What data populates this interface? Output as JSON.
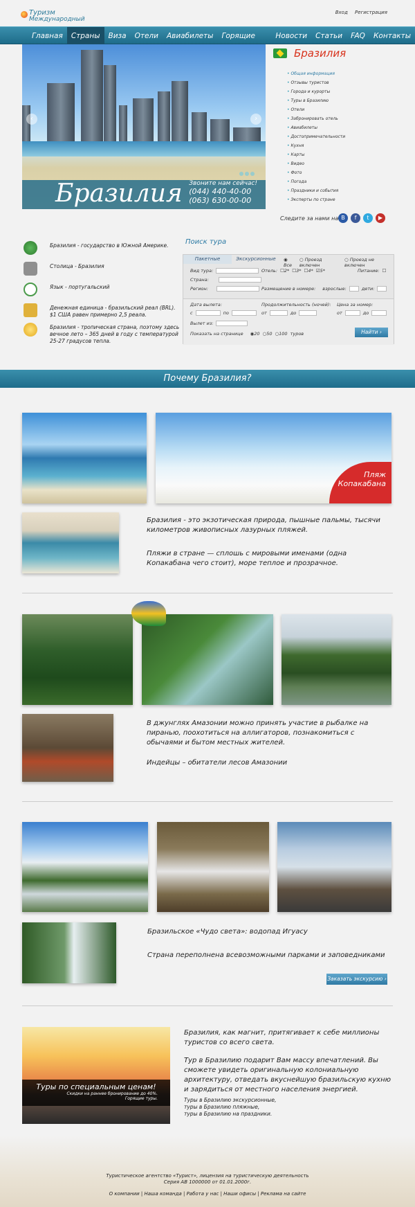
{
  "logo": {
    "line1": "Туризм",
    "line2": "Международный"
  },
  "top_links": {
    "login": "Вход",
    "register": "Регистрация"
  },
  "nav": [
    "Главная",
    "Страны",
    "Виза",
    "Отели",
    "Авиабилеты",
    "Горящие туры",
    "Новости",
    "Статьи",
    "FAQ",
    "Контакты"
  ],
  "nav_active": "Страны",
  "hero": {
    "title": "Бразилия",
    "call": "Звоните нам сейчас!",
    "phone1": "(044) 440-40-00",
    "phone2": "(063) 630-00-00"
  },
  "side": {
    "title": "Бразилия",
    "items": [
      "Общая информация",
      "Отзывы туристов",
      "Города и курорты",
      "Туры в Бразилию",
      "Отели",
      "Забронировать отель",
      "Авиабилеты",
      "Достопримечательности",
      "Кухня",
      "Карты",
      "Видео",
      "Фото",
      "Погода",
      "Праздники и события",
      "Эксперты по стране"
    ],
    "active": "Общая информация"
  },
  "follow": "Следите за нами на",
  "social": [
    "B",
    "f",
    "t",
    "▶"
  ],
  "facts": [
    "Бразилия - государство в Южной Америке.",
    "Столица - Бразилия",
    "Язык - португальский",
    "Денежная единица - бразильский реал (BRL). $1 США равен примерно 2,5 реала.",
    "Бразилия - тропическая страна, поэтому здесь вечное лето – 365 дней в году с температурой 25-27 градусов тепла."
  ],
  "search": {
    "title": "Поиск тура",
    "tabs": [
      "Пакетные",
      "Экскурсионные"
    ],
    "transport": [
      "Все",
      "Проезд включен",
      "Проезд не включен"
    ],
    "tour_type": "Вид тура:",
    "hotel": "Отель:",
    "stars": [
      "2*",
      "3*",
      "4*",
      "5*"
    ],
    "food": "Питание:",
    "country": "Страна:",
    "region": "Регион:",
    "placement": "Размещение в номере:",
    "adults": "взрослые:",
    "children": "дети:",
    "departure": "Дата вылета:",
    "date_from": "с",
    "date_to": "по",
    "duration": "Продолжительность (ночей):",
    "dur_from": "от",
    "dur_to": "до",
    "price": "Цена за номер:",
    "price_from": "от",
    "price_to": "до",
    "from_city": "Вылет из:",
    "show": "Показать на странице",
    "show_opts": [
      "20",
      "50",
      "100"
    ],
    "tours": "туров",
    "button": "Найти ›"
  },
  "why_title": "Почему Бразилия?",
  "section1": {
    "badge": "Пляж Копакабана",
    "text1": "Бразилия - это экзотическая природа, пышные пальмы, тысячи километров живописных лазурных пляжей.",
    "text2": "Пляжи в стране — сплошь с мировыми именами (одна Копакабана чего стоит), море теплое и прозрачное."
  },
  "section2": {
    "text1": "В джунглях Амазонии можно принять участие в рыбалке на пиранью, поохотиться на аллигаторов, познакомиться с обычаями и бытом местных жителей.",
    "text2": "Индейцы – обитатели лесов Амазонии"
  },
  "section3": {
    "text1": "Бразильское «Чудо света»: водопад Игуасу",
    "text2": "Страна переполнена всевозможными парками и заповедниками",
    "order_button": "Заказать экскурсию ›"
  },
  "section4": {
    "banner": "Туры по специальным ценам!",
    "banner_sub1": "Скидки на раннее бронирование до 40%.",
    "banner_sub2": "Горящие туры.",
    "p1": "Бразилия, как магнит, притягивает к себе миллионы туристов со всего света.",
    "p2": "Тур в Бразилию подарит Вам массу впечатлений. Вы сможете увидеть оригинальную колониальную архитектуру, отведать вкуснейшую бразильскую кухню и зарядиться от местного населения энергией.",
    "links": [
      "Туры в Бразилию экскурсионные,",
      "туры в Бразилию пляжные,",
      "туры в Бразилию на праздники."
    ]
  },
  "footer": {
    "line1": "Туристическое агентство «Турист», лицензия на туристическую деятельность",
    "line2": "Серия АВ 1000000 от 01.01.2000г.",
    "links": [
      "О компании",
      "Наша команда",
      "Работа у нас",
      "Наши офисы",
      "Реклама на сайте"
    ]
  }
}
